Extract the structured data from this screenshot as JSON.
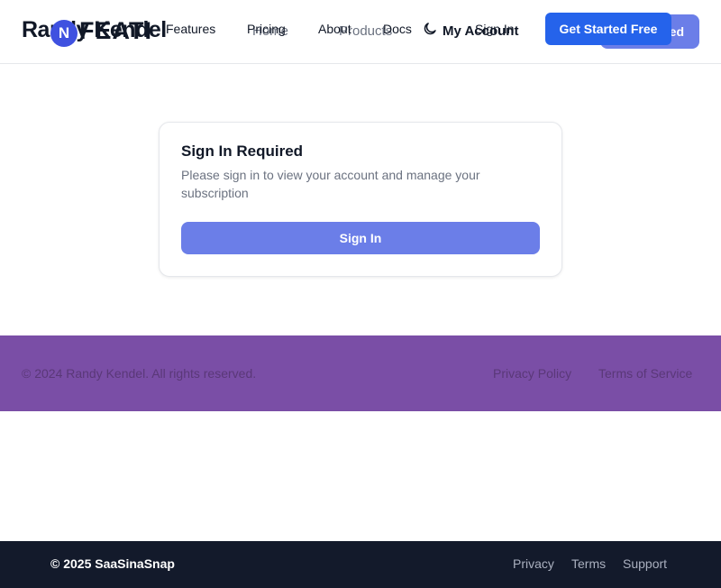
{
  "header_under": {
    "brand": "Randy Kendel",
    "nav": [
      "Home",
      "Products"
    ],
    "account_label": "My Account",
    "cta_label": "Get Started"
  },
  "header_over": {
    "logo_letter": "N",
    "brand": "FEATI",
    "nav": [
      "Features",
      "Pricing",
      "About",
      "Docs"
    ],
    "theme_icon": "moon-icon",
    "sign_in_label": "Sign In",
    "cta_label": "Get Started Free"
  },
  "signin_card": {
    "title": "Sign In Required",
    "description": "Please sign in to view your account and manage your subscription",
    "button_label": "Sign In"
  },
  "purple_footer": {
    "copyright": "© 2024 Randy Kendel. All rights reserved.",
    "links": [
      "Privacy Policy",
      "Terms of Service"
    ]
  },
  "dark_footer": {
    "copyright": "© 2025 SaaSinaSnap",
    "links": [
      "Privacy",
      "Terms",
      "Support"
    ]
  },
  "colors": {
    "primary": "#2563eb",
    "primary_soft": "#6b7ee8",
    "purple_footer_bg": "#7a4ea6",
    "dark_footer_bg": "#131a2b"
  }
}
